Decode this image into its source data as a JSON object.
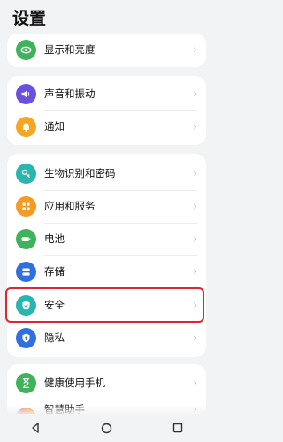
{
  "header": {
    "title": "设置"
  },
  "groups": [
    {
      "items": [
        {
          "label": "显示和亮度",
          "icon": "eye-icon",
          "color": "#3fb35a"
        }
      ]
    },
    {
      "items": [
        {
          "label": "声音和振动",
          "icon": "speaker-icon",
          "color": "#6d4fe0"
        },
        {
          "label": "通知",
          "icon": "bell-icon",
          "color": "#f5a623"
        }
      ]
    },
    {
      "items": [
        {
          "label": "生物识别和密码",
          "icon": "key-icon",
          "color": "#29b6b0"
        },
        {
          "label": "应用和服务",
          "icon": "apps-icon",
          "color": "#f59a23"
        },
        {
          "label": "电池",
          "icon": "battery-icon",
          "color": "#3fb35a"
        },
        {
          "label": "存储",
          "icon": "storage-icon",
          "color": "#2f6fe0"
        },
        {
          "label": "安全",
          "icon": "shield-check-icon",
          "color": "#29b6b0",
          "highlighted": true
        },
        {
          "label": "隐私",
          "icon": "privacy-shield-icon",
          "color": "#2f6fe0"
        }
      ]
    },
    {
      "items": [
        {
          "label": "健康使用手机",
          "icon": "hourglass-icon",
          "color": "#3fb35a"
        },
        {
          "label": "智慧助手",
          "icon": "assistant-icon",
          "color": "#e07ad0"
        }
      ]
    }
  ],
  "chevron": "›",
  "navbar": {
    "back": "back-icon",
    "home": "home-icon",
    "recents": "recents-icon"
  }
}
